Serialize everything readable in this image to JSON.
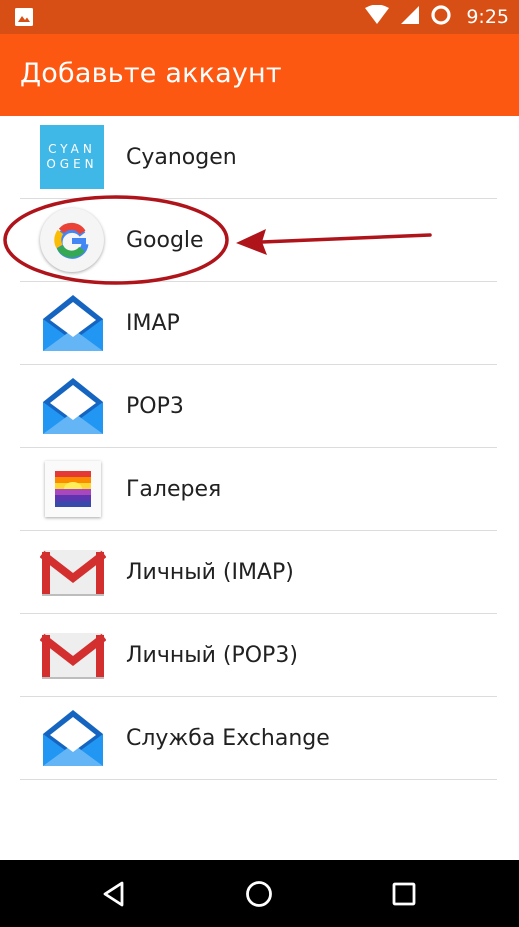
{
  "status_bar": {
    "time": "9:25",
    "icons": [
      "image-notification-icon",
      "wifi-icon",
      "signal-icon",
      "sync-icon"
    ]
  },
  "header": {
    "title": "Добавьте аккаунт"
  },
  "accounts": [
    {
      "label": "Cyanogen",
      "icon": "cyanogen-icon",
      "logo_lines": [
        "CYAN",
        "OGEN"
      ]
    },
    {
      "label": "Google",
      "icon": "google-icon"
    },
    {
      "label": "IMAP",
      "icon": "email-icon"
    },
    {
      "label": "POP3",
      "icon": "email-icon"
    },
    {
      "label": "Галерея",
      "icon": "gallery-icon"
    },
    {
      "label": "Личный (IMAP)",
      "icon": "gmail-icon"
    },
    {
      "label": "Личный (POP3)",
      "icon": "gmail-icon"
    },
    {
      "label": "Служба Exchange",
      "icon": "email-icon"
    }
  ],
  "annotation": {
    "highlighted_item": "Google",
    "color": "#b0141b"
  },
  "nav_bar": {
    "icons": [
      "back-icon",
      "home-icon",
      "recents-icon"
    ]
  },
  "colors": {
    "status_bar": "#d84f15",
    "app_bar": "#fd5812",
    "email_blue": "#1e88e5",
    "gmail_red": "#d32f2f",
    "cyan": "#3fb8e8"
  }
}
